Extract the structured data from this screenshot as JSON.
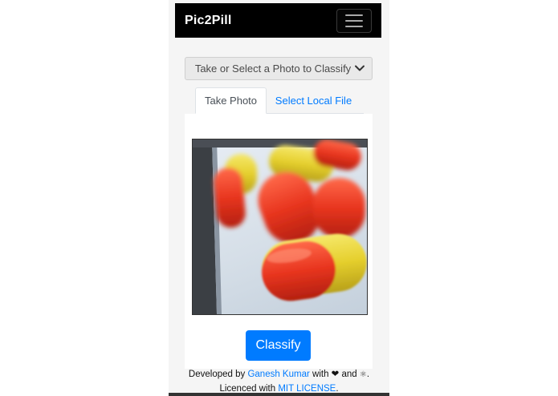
{
  "app": {
    "brand": "Pic2Pill",
    "menu_icon": "hamburger-icon"
  },
  "selector": {
    "value": "Take or Select a Photo to Classify",
    "icon": "chevron-down-icon"
  },
  "tabs": [
    {
      "label": "Take Photo",
      "active": true
    },
    {
      "label": "Select Local File",
      "active": false
    }
  ],
  "photo": {
    "subject": "red and yellow capsule pills"
  },
  "actions": {
    "classify_label": "Classify"
  },
  "footer": {
    "developed_prefix": "Developed by",
    "author": "Ganesh Kumar",
    "with_text": "with",
    "heart": "❤",
    "and_text": "and",
    "react_symbol": "⚛",
    "period": ".",
    "licenced_prefix": "Licenced with",
    "license": "MIT LICENSE",
    "license_period": "."
  },
  "colors": {
    "primary": "#007bff",
    "navbar": "#000000"
  }
}
